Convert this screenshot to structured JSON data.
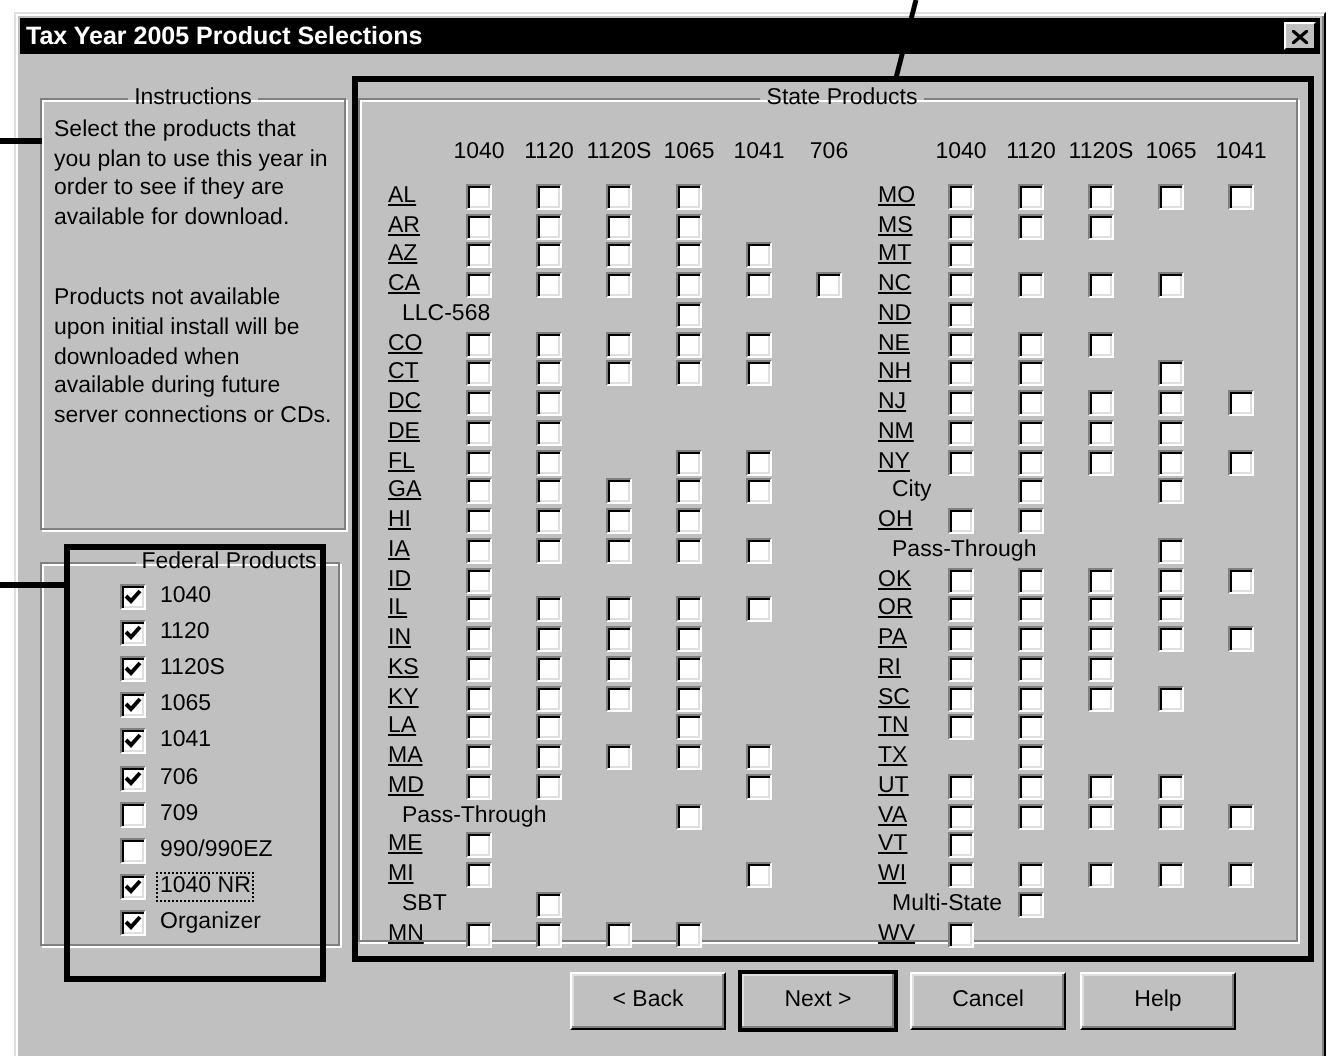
{
  "window": {
    "title": "Tax Year 2005 Product Selections"
  },
  "instructions": {
    "legend": "Instructions",
    "paragraphs": [
      "Select the products that you plan to use this year in order to see if they are available for download.",
      "Products not available upon initial install will be downloaded when available during future server connections or CDs."
    ]
  },
  "federal_products": {
    "legend": "Federal Products",
    "items": [
      {
        "label": "1040",
        "checked": true,
        "focused": false
      },
      {
        "label": "1120",
        "checked": true,
        "focused": false
      },
      {
        "label": "1120S",
        "checked": true,
        "focused": false
      },
      {
        "label": "1065",
        "checked": true,
        "focused": false
      },
      {
        "label": "1041",
        "checked": true,
        "focused": false
      },
      {
        "label": "706",
        "checked": true,
        "focused": false
      },
      {
        "label": "709",
        "checked": false,
        "focused": false
      },
      {
        "label": "990/990EZ",
        "checked": false,
        "focused": false
      },
      {
        "label": "1040 NR",
        "checked": true,
        "focused": true
      },
      {
        "label": "Organizer",
        "checked": true,
        "focused": false
      }
    ]
  },
  "state_products": {
    "legend": "State Products",
    "groups": [
      {
        "columns": [
          "1040",
          "1120",
          "1120S",
          "1065",
          "1041",
          "706"
        ],
        "rows": [
          {
            "label": "AL",
            "kind": "state",
            "boxes": [
              {
                "kind": "checkbox",
                "checked": false
              },
              {
                "kind": "checkbox",
                "checked": false
              },
              {
                "kind": "checkbox",
                "checked": false
              },
              {
                "kind": "checkbox",
                "checked": false
              }
            ]
          },
          {
            "label": "AR",
            "kind": "state",
            "boxes": [
              {
                "kind": "checkbox",
                "checked": false
              },
              {
                "kind": "checkbox",
                "checked": false
              },
              {
                "kind": "checkbox",
                "checked": false
              },
              {
                "kind": "checkbox",
                "checked": false
              }
            ]
          },
          {
            "label": "AZ",
            "kind": "state",
            "boxes": [
              {
                "kind": "checkbox",
                "checked": false
              },
              {
                "kind": "checkbox",
                "checked": false
              },
              {
                "kind": "checkbox",
                "checked": false
              },
              {
                "kind": "checkbox",
                "checked": false
              },
              {
                "kind": "checkbox",
                "checked": false
              }
            ]
          },
          {
            "label": "CA",
            "kind": "state",
            "boxes": [
              {
                "kind": "checkbox",
                "checked": false
              },
              {
                "kind": "checkbox",
                "checked": false
              },
              {
                "kind": "checkbox",
                "checked": false
              },
              {
                "kind": "checkbox",
                "checked": false
              },
              {
                "kind": "checkbox",
                "checked": false
              },
              {
                "kind": "checkbox",
                "checked": false
              }
            ]
          },
          {
            "label": "LLC-568",
            "kind": "note",
            "boxes": [
              {
                "kind": "blank"
              },
              {
                "kind": "blank"
              },
              {
                "kind": "blank"
              },
              {
                "kind": "checkbox",
                "checked": false
              }
            ]
          },
          {
            "label": "CO",
            "kind": "state",
            "boxes": [
              {
                "kind": "checkbox",
                "checked": false
              },
              {
                "kind": "checkbox",
                "checked": false
              },
              {
                "kind": "checkbox",
                "checked": false
              },
              {
                "kind": "checkbox",
                "checked": false
              },
              {
                "kind": "checkbox",
                "checked": false
              }
            ]
          },
          {
            "label": "CT",
            "kind": "state",
            "boxes": [
              {
                "kind": "checkbox",
                "checked": false
              },
              {
                "kind": "checkbox",
                "checked": false
              },
              {
                "kind": "checkbox",
                "checked": false
              },
              {
                "kind": "checkbox",
                "checked": false
              },
              {
                "kind": "checkbox",
                "checked": false
              }
            ]
          },
          {
            "label": "DC",
            "kind": "state",
            "boxes": [
              {
                "kind": "checkbox",
                "checked": false
              },
              {
                "kind": "checkbox",
                "checked": false
              }
            ]
          },
          {
            "label": "DE",
            "kind": "state",
            "boxes": [
              {
                "kind": "checkbox",
                "checked": false
              },
              {
                "kind": "checkbox",
                "checked": false
              }
            ]
          },
          {
            "label": "FL",
            "kind": "state",
            "boxes": [
              {
                "kind": "checkbox",
                "checked": false
              },
              {
                "kind": "checkbox",
                "checked": false
              },
              {
                "kind": "blank"
              },
              {
                "kind": "checkbox",
                "checked": false
              },
              {
                "kind": "checkbox",
                "checked": false
              }
            ]
          },
          {
            "label": "GA",
            "kind": "state",
            "boxes": [
              {
                "kind": "checkbox",
                "checked": false
              },
              {
                "kind": "checkbox",
                "checked": false
              },
              {
                "kind": "checkbox",
                "checked": false
              },
              {
                "kind": "checkbox",
                "checked": false
              },
              {
                "kind": "checkbox",
                "checked": false
              }
            ]
          },
          {
            "label": "HI",
            "kind": "state",
            "boxes": [
              {
                "kind": "checkbox",
                "checked": false
              },
              {
                "kind": "checkbox",
                "checked": false
              },
              {
                "kind": "checkbox",
                "checked": false
              },
              {
                "kind": "checkbox",
                "checked": false
              }
            ]
          },
          {
            "label": "IA",
            "kind": "state",
            "boxes": [
              {
                "kind": "checkbox",
                "checked": false
              },
              {
                "kind": "checkbox",
                "checked": false
              },
              {
                "kind": "checkbox",
                "checked": false
              },
              {
                "kind": "checkbox",
                "checked": false
              },
              {
                "kind": "checkbox",
                "checked": false
              }
            ]
          },
          {
            "label": "ID",
            "kind": "state",
            "boxes": [
              {
                "kind": "checkbox",
                "checked": false
              }
            ]
          },
          {
            "label": "IL",
            "kind": "state",
            "boxes": [
              {
                "kind": "checkbox",
                "checked": false
              },
              {
                "kind": "checkbox",
                "checked": false
              },
              {
                "kind": "checkbox",
                "checked": false
              },
              {
                "kind": "checkbox",
                "checked": false
              },
              {
                "kind": "checkbox",
                "checked": false
              }
            ]
          },
          {
            "label": "IN",
            "kind": "state",
            "boxes": [
              {
                "kind": "checkbox",
                "checked": false
              },
              {
                "kind": "checkbox",
                "checked": false
              },
              {
                "kind": "checkbox",
                "checked": false
              },
              {
                "kind": "checkbox",
                "checked": false
              }
            ]
          },
          {
            "label": "KS",
            "kind": "state",
            "boxes": [
              {
                "kind": "checkbox",
                "checked": false
              },
              {
                "kind": "checkbox",
                "checked": false
              },
              {
                "kind": "checkbox",
                "checked": false
              },
              {
                "kind": "checkbox",
                "checked": false
              }
            ]
          },
          {
            "label": "KY",
            "kind": "state",
            "boxes": [
              {
                "kind": "checkbox",
                "checked": false
              },
              {
                "kind": "checkbox",
                "checked": false
              },
              {
                "kind": "checkbox",
                "checked": false
              },
              {
                "kind": "checkbox",
                "checked": false
              }
            ]
          },
          {
            "label": "LA",
            "kind": "state",
            "boxes": [
              {
                "kind": "checkbox",
                "checked": false
              },
              {
                "kind": "checkbox",
                "checked": false
              },
              {
                "kind": "blank"
              },
              {
                "kind": "checkbox",
                "checked": false
              }
            ]
          },
          {
            "label": "MA",
            "kind": "state",
            "boxes": [
              {
                "kind": "checkbox",
                "checked": false
              },
              {
                "kind": "checkbox",
                "checked": false
              },
              {
                "kind": "checkbox",
                "checked": false
              },
              {
                "kind": "checkbox",
                "checked": false
              },
              {
                "kind": "checkbox",
                "checked": false
              }
            ]
          },
          {
            "label": "MD",
            "kind": "state",
            "boxes": [
              {
                "kind": "checkbox",
                "checked": false
              },
              {
                "kind": "checkbox",
                "checked": false
              },
              {
                "kind": "blank"
              },
              {
                "kind": "blank"
              },
              {
                "kind": "checkbox",
                "checked": false
              }
            ]
          },
          {
            "label": "Pass-Through",
            "kind": "note",
            "boxes": [
              {
                "kind": "blank"
              },
              {
                "kind": "blank"
              },
              {
                "kind": "blank"
              },
              {
                "kind": "checkbox",
                "checked": false
              }
            ]
          },
          {
            "label": "ME",
            "kind": "state",
            "boxes": [
              {
                "kind": "checkbox",
                "checked": false
              }
            ]
          },
          {
            "label": "MI",
            "kind": "state",
            "boxes": [
              {
                "kind": "checkbox",
                "checked": false
              },
              {
                "kind": "blank"
              },
              {
                "kind": "blank"
              },
              {
                "kind": "blank"
              },
              {
                "kind": "checkbox",
                "checked": false
              }
            ]
          },
          {
            "label": "SBT",
            "kind": "note",
            "boxes": [
              {
                "kind": "blank"
              },
              {
                "kind": "checkbox",
                "checked": false
              }
            ]
          },
          {
            "label": "MN",
            "kind": "state",
            "boxes": [
              {
                "kind": "checkbox",
                "checked": false
              },
              {
                "kind": "checkbox",
                "checked": false
              },
              {
                "kind": "checkbox",
                "checked": false
              },
              {
                "kind": "checkbox",
                "checked": false
              }
            ]
          }
        ]
      },
      {
        "columns": [
          "1040",
          "1120",
          "1120S",
          "1065",
          "1041"
        ],
        "rows": [
          {
            "label": "MO",
            "kind": "state",
            "boxes": [
              {
                "kind": "checkbox",
                "checked": false
              },
              {
                "kind": "checkbox",
                "checked": false
              },
              {
                "kind": "checkbox",
                "checked": false
              },
              {
                "kind": "checkbox",
                "checked": false
              },
              {
                "kind": "checkbox",
                "checked": false
              }
            ]
          },
          {
            "label": "MS",
            "kind": "state",
            "boxes": [
              {
                "kind": "checkbox",
                "checked": false
              },
              {
                "kind": "checkbox",
                "checked": false
              },
              {
                "kind": "checkbox",
                "checked": false
              }
            ]
          },
          {
            "label": "MT",
            "kind": "state",
            "boxes": [
              {
                "kind": "checkbox",
                "checked": false
              }
            ]
          },
          {
            "label": "NC",
            "kind": "state",
            "boxes": [
              {
                "kind": "checkbox",
                "checked": false
              },
              {
                "kind": "checkbox",
                "checked": false
              },
              {
                "kind": "checkbox",
                "checked": false
              },
              {
                "kind": "checkbox",
                "checked": false
              }
            ]
          },
          {
            "label": "ND",
            "kind": "state",
            "boxes": [
              {
                "kind": "checkbox",
                "checked": false
              }
            ]
          },
          {
            "label": "NE",
            "kind": "state",
            "boxes": [
              {
                "kind": "checkbox",
                "checked": false
              },
              {
                "kind": "checkbox",
                "checked": false
              },
              {
                "kind": "checkbox",
                "checked": false
              }
            ]
          },
          {
            "label": "NH",
            "kind": "state",
            "boxes": [
              {
                "kind": "checkbox",
                "checked": false
              },
              {
                "kind": "checkbox",
                "checked": false
              },
              {
                "kind": "blank"
              },
              {
                "kind": "checkbox",
                "checked": false
              }
            ]
          },
          {
            "label": "NJ",
            "kind": "state",
            "boxes": [
              {
                "kind": "checkbox",
                "checked": false
              },
              {
                "kind": "checkbox",
                "checked": false
              },
              {
                "kind": "checkbox",
                "checked": false
              },
              {
                "kind": "checkbox",
                "checked": false
              },
              {
                "kind": "checkbox",
                "checked": false
              }
            ]
          },
          {
            "label": "NM",
            "kind": "state",
            "boxes": [
              {
                "kind": "checkbox",
                "checked": false
              },
              {
                "kind": "checkbox",
                "checked": false
              },
              {
                "kind": "checkbox",
                "checked": false
              },
              {
                "kind": "checkbox",
                "checked": false
              }
            ]
          },
          {
            "label": "NY",
            "kind": "state",
            "boxes": [
              {
                "kind": "checkbox",
                "checked": false
              },
              {
                "kind": "checkbox",
                "checked": false
              },
              {
                "kind": "checkbox",
                "checked": false
              },
              {
                "kind": "checkbox",
                "checked": false
              },
              {
                "kind": "checkbox",
                "checked": false
              }
            ]
          },
          {
            "label": "City",
            "kind": "note",
            "boxes": [
              {
                "kind": "blank"
              },
              {
                "kind": "checkbox",
                "checked": false
              },
              {
                "kind": "blank"
              },
              {
                "kind": "checkbox",
                "checked": false
              }
            ]
          },
          {
            "label": "OH",
            "kind": "state",
            "boxes": [
              {
                "kind": "checkbox",
                "checked": false
              },
              {
                "kind": "checkbox",
                "checked": false
              }
            ]
          },
          {
            "label": "Pass-Through",
            "kind": "note",
            "boxes": [
              {
                "kind": "blank"
              },
              {
                "kind": "blank"
              },
              {
                "kind": "blank"
              },
              {
                "kind": "checkbox",
                "checked": false
              }
            ]
          },
          {
            "label": "OK",
            "kind": "state",
            "boxes": [
              {
                "kind": "checkbox",
                "checked": false
              },
              {
                "kind": "checkbox",
                "checked": false
              },
              {
                "kind": "checkbox",
                "checked": false
              },
              {
                "kind": "checkbox",
                "checked": false
              },
              {
                "kind": "checkbox",
                "checked": false
              }
            ]
          },
          {
            "label": "OR",
            "kind": "state",
            "boxes": [
              {
                "kind": "checkbox",
                "checked": false
              },
              {
                "kind": "checkbox",
                "checked": false
              },
              {
                "kind": "checkbox",
                "checked": false
              },
              {
                "kind": "checkbox",
                "checked": false
              }
            ]
          },
          {
            "label": "PA",
            "kind": "state",
            "boxes": [
              {
                "kind": "checkbox",
                "checked": false
              },
              {
                "kind": "checkbox",
                "checked": false
              },
              {
                "kind": "checkbox",
                "checked": false
              },
              {
                "kind": "checkbox",
                "checked": false
              },
              {
                "kind": "checkbox",
                "checked": false
              }
            ]
          },
          {
            "label": "RI",
            "kind": "state",
            "boxes": [
              {
                "kind": "checkbox",
                "checked": false
              },
              {
                "kind": "checkbox",
                "checked": false
              },
              {
                "kind": "checkbox",
                "checked": false
              }
            ]
          },
          {
            "label": "SC",
            "kind": "state",
            "boxes": [
              {
                "kind": "checkbox",
                "checked": false
              },
              {
                "kind": "checkbox",
                "checked": false
              },
              {
                "kind": "checkbox",
                "checked": false
              },
              {
                "kind": "checkbox",
                "checked": false
              }
            ]
          },
          {
            "label": "TN",
            "kind": "state",
            "boxes": [
              {
                "kind": "checkbox",
                "checked": false
              },
              {
                "kind": "checkbox",
                "checked": false
              }
            ]
          },
          {
            "label": "TX",
            "kind": "state",
            "boxes": [
              {
                "kind": "blank"
              },
              {
                "kind": "checkbox",
                "checked": false
              }
            ]
          },
          {
            "label": "UT",
            "kind": "state",
            "boxes": [
              {
                "kind": "checkbox",
                "checked": false
              },
              {
                "kind": "checkbox",
                "checked": false
              },
              {
                "kind": "checkbox",
                "checked": false
              },
              {
                "kind": "checkbox",
                "checked": false
              }
            ]
          },
          {
            "label": "VA",
            "kind": "state",
            "boxes": [
              {
                "kind": "checkbox",
                "checked": false
              },
              {
                "kind": "checkbox",
                "checked": false
              },
              {
                "kind": "checkbox",
                "checked": false
              },
              {
                "kind": "checkbox",
                "checked": false
              },
              {
                "kind": "checkbox",
                "checked": false
              }
            ]
          },
          {
            "label": "VT",
            "kind": "state",
            "boxes": [
              {
                "kind": "checkbox",
                "checked": false
              }
            ]
          },
          {
            "label": "WI",
            "kind": "state",
            "boxes": [
              {
                "kind": "checkbox",
                "checked": false
              },
              {
                "kind": "checkbox",
                "checked": false
              },
              {
                "kind": "checkbox",
                "checked": false
              },
              {
                "kind": "checkbox",
                "checked": false
              },
              {
                "kind": "checkbox",
                "checked": false
              }
            ]
          },
          {
            "label": "Multi-State",
            "kind": "note",
            "boxes": [
              {
                "kind": "blank"
              },
              {
                "kind": "checkbox",
                "checked": false
              }
            ]
          },
          {
            "label": "WV",
            "kind": "state",
            "boxes": [
              {
                "kind": "checkbox",
                "checked": false
              }
            ]
          }
        ]
      }
    ]
  },
  "buttons": [
    {
      "label": "< Back",
      "default": false
    },
    {
      "label": "Next >",
      "default": true
    },
    {
      "label": "Cancel",
      "default": false
    },
    {
      "label": "Help",
      "default": false
    }
  ]
}
